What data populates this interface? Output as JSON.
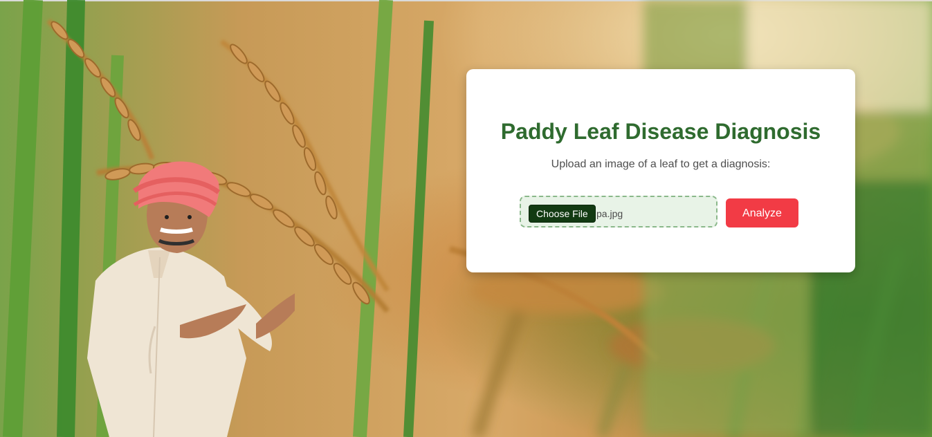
{
  "card": {
    "title": "Paddy Leaf Disease Diagnosis",
    "subtitle": "Upload an image of a leaf to get a diagnosis:"
  },
  "upload": {
    "choose_button_label": "Choose File",
    "file_name": "pa.jpg"
  },
  "actions": {
    "analyze_label": "Analyze"
  },
  "colors": {
    "title_green": "#2f6b2f",
    "analyze_red": "#f23b45",
    "file_box_bg": "#e8f3e7",
    "file_box_border": "#8ab88a",
    "choose_button_bg": "#123a12"
  }
}
